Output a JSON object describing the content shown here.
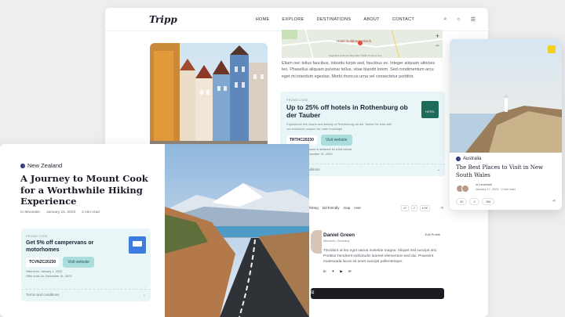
{
  "nav": {
    "logo": "Tripp",
    "links": [
      "HOME",
      "EXPLORE",
      "DESTINATIONS",
      "ABOUT",
      "CONTACT"
    ]
  },
  "map": {
    "place_label": "Hotel Goldener Hirsch",
    "footer": "Keyboard shortcuts   Map data ©2023   Terms of Use"
  },
  "article": {
    "paragraph": "Etiam nec tellus faucibus, lobortis turpis sed, faucibus ex. Integer aliquam ultricies leo. Phasellus aliquam pulvinar tellus, vitae blandit lorem. Sed condimentum arcu eget mi interdum egestas. Morbi rhoncus urna vel consectetur porttitor.",
    "tags": [
      "hiking",
      "kid-friendly",
      "map",
      "river"
    ]
  },
  "promo_hotels": {
    "tag": "PROMO CODE",
    "title": "Up to 25% off hotels in Rothenburg ob der Tauber",
    "description": "Experience the charm and beauty of Rothenburg ob der Tauber for less with our exclusive coupon for hotel bookings!",
    "logo_text": "HOTEL",
    "code": "TRTHC20230",
    "button": "Visit website",
    "line1": "Cancel up to 24 hours in advance for a full refund",
    "line2": "Offer ends on: December 31, 2023",
    "terms": "Terms and conditions"
  },
  "stats": {
    "likes": "47",
    "comments": "2",
    "views": "6.5K"
  },
  "author": {
    "name": "Daniel Green",
    "location": "München, Germany",
    "edit": "Edit Profile",
    "bio": "Tincidunt ut leo eget varius molestie magna. Aliquet nisl suscipit nisi. Porttitor hendrerit sollicitudin laoreet elementum sed dui. Praesent malesuada lacus sit amet suscipit pellentesque."
  },
  "dark_bar_label": "0)",
  "nz_card": {
    "country": "New Zealand",
    "title": "A Journey to Mount Cook for a Worthwhile Hiking Experience",
    "category": "In Mountain",
    "date": "January 15, 2023",
    "read_time": "2 min read",
    "promo": {
      "tag": "PROMO CODE",
      "title": "Get 5% off campervans or motorhomes",
      "code": "TCVNZC20230",
      "button": "Visit website",
      "valid": "Valid from: January 1, 2023",
      "ends": "Offer ends on: December 31, 2023",
      "terms": "Terms and conditions"
    }
  },
  "au_card": {
    "country": "Australia",
    "title": "The Best Places to Visit in New South Wales",
    "category": "In Landmark",
    "date": "January 17, 2023",
    "read_time": "2 min read",
    "stats": {
      "views": "32",
      "comments": "2",
      "likes": "286"
    }
  },
  "colors": {
    "promo_bg": "#e8f6f7",
    "button_bg": "#a9dedd",
    "dark_bar": "#1b1d22"
  }
}
